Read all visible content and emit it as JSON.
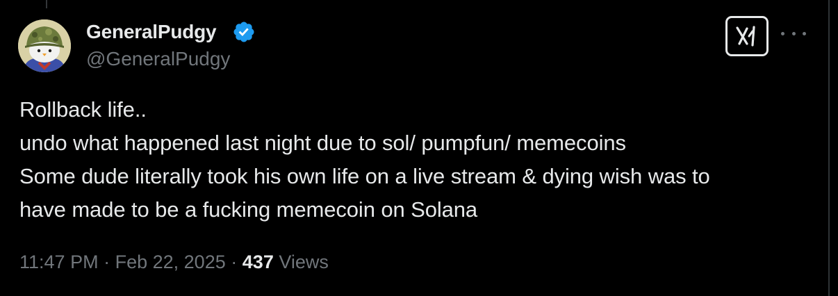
{
  "author": {
    "display_name": "GeneralPudgy",
    "handle": "@GeneralPudgy",
    "avatar_icon": "pudgy-penguin-soldier-avatar",
    "verified_icon": "verified-badge-icon",
    "verified_color": "#1d9bf0"
  },
  "actions": {
    "grok_icon": "grok-icon",
    "more_icon": "more-options-icon"
  },
  "tweet": {
    "lines": [
      "Rollback life..",
      "undo what happened last night due to sol/ pumpfun/ memecoins",
      "Some dude literally took his own life on a live stream & dying wish was to",
      "have made to be a fucking memecoin on Solana"
    ]
  },
  "meta": {
    "time": "11:47 PM",
    "separator": "·",
    "date": "Feb 22, 2025",
    "views_count": "437",
    "views_label": "Views"
  },
  "colors": {
    "background": "#000000",
    "primary_text": "#e7e9ea",
    "secondary_text": "#71767b"
  }
}
